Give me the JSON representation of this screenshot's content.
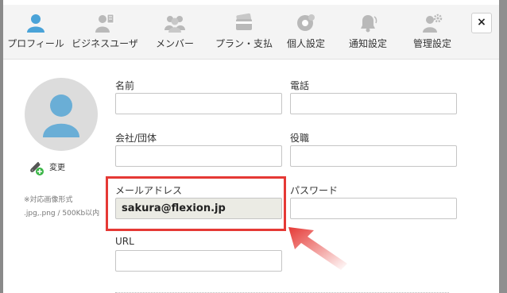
{
  "tabs": [
    {
      "label": "プロフィール",
      "icon": "person-icon",
      "active": true
    },
    {
      "label": "ビジネスユーザ",
      "icon": "business-user-icon"
    },
    {
      "label": "メンバー",
      "icon": "members-icon"
    },
    {
      "label": "プラン・支払",
      "icon": "credit-card-icon"
    },
    {
      "label": "個人設定",
      "icon": "personal-settings-icon"
    },
    {
      "label": "通知設定",
      "icon": "bell-icon"
    },
    {
      "label": "管理設定",
      "icon": "admin-gear-icon"
    }
  ],
  "close_label": "×",
  "avatar": {
    "change_label": "変更",
    "note_line1": "※対応画像形式",
    "note_line2": ".jpg,.png / 500Kb以内"
  },
  "fields": {
    "name": {
      "label": "名前",
      "value": ""
    },
    "phone": {
      "label": "電話",
      "value": ""
    },
    "company": {
      "label": "会社/団体",
      "value": ""
    },
    "position": {
      "label": "役職",
      "value": ""
    },
    "email": {
      "label": "メールアドレス",
      "value": "sakura@flexion.jp"
    },
    "password": {
      "label": "パスワード",
      "value": ""
    },
    "url": {
      "label": "URL",
      "value": ""
    }
  },
  "colors": {
    "active_tab": "#4aa3d8",
    "inactive_icon": "#b9b9b9",
    "highlight": "#e53935",
    "readonly_input": "#ebebe4"
  }
}
